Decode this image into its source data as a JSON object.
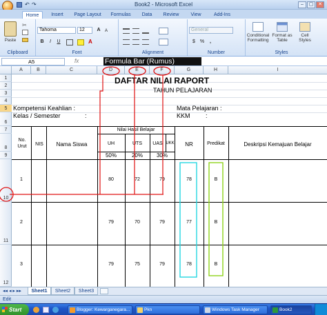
{
  "window": {
    "title": "Book2 - Microsoft Excel",
    "minimize": "–",
    "restore": "▢",
    "close": "✕"
  },
  "tabs": [
    "Home",
    "Insert",
    "Page Layout",
    "Formulas",
    "Data",
    "Review",
    "View",
    "Add-Ins"
  ],
  "ribbon": {
    "clipboard": {
      "label": "Clipboard",
      "paste": "Paste"
    },
    "font": {
      "label": "Font",
      "name": "Tahoma",
      "size": "12",
      "grow": "A",
      "shrink": "A",
      "bold": "B",
      "italic": "I",
      "underline": "U"
    },
    "alignment": {
      "label": "Alignment"
    },
    "number": {
      "label": "Number",
      "format": "General",
      "currency": "$",
      "percent": "%",
      "comma": ","
    },
    "styles": {
      "label": "Styles",
      "conditional": "Conditional Formatting",
      "format_table": "Format as Table",
      "cell_styles": "Cell Styles"
    }
  },
  "formula_bar": {
    "name_box": "A5",
    "fx": "fx",
    "annotation": "Formula Bar (Rumus)"
  },
  "columns": [
    "A",
    "B",
    "C",
    "D",
    "E",
    "F",
    "G",
    "H",
    "I"
  ],
  "rows": [
    "1",
    "2",
    "3",
    "4",
    "5",
    "6",
    "7",
    "8",
    "9",
    "10",
    "11",
    "12"
  ],
  "sheet": {
    "title": "DAFTAR NILAI RAPORT",
    "subtitle": "TAHUN PELAJARAN",
    "kompetensi": "Kompetensi Keahlian    :",
    "mata_pelajaran": "Mata Pelajaran :",
    "kelas": "Kelas / Semester",
    "kelas_colon": ":",
    "kkm": "KKM",
    "kkm_colon": ":",
    "headers": {
      "no_urut": "No. Urut",
      "nis": "NIS",
      "nama": "Nama Siswa",
      "nilai_hasil": "Nilai Hasil Belajar",
      "uh": "UH",
      "uts": "UTS",
      "uas": "UAS",
      "ukk": "UKK",
      "nr": "NR",
      "predikat": "Predikat",
      "deskripsi": "Deskripsi Kemajuan Belajar"
    },
    "weights": {
      "uh": "50%",
      "uts": "20%",
      "uas": "30%"
    },
    "students": [
      {
        "no": "1",
        "uh": "80",
        "uts": "72",
        "uas": "79",
        "nr": "78",
        "predikat": "B"
      },
      {
        "no": "2",
        "uh": "79",
        "uts": "70",
        "uas": "79",
        "nr": "77",
        "predikat": "B"
      },
      {
        "no": "3",
        "uh": "79",
        "uts": "75",
        "uas": "79",
        "nr": "78",
        "predikat": "B"
      }
    ]
  },
  "sheet_tabs": [
    "Sheet1",
    "Sheet2",
    "Sheet3"
  ],
  "status": "Edit",
  "taskbar": {
    "start": "Start",
    "tasks": [
      "Blogger: Kewarganegara...",
      "Pkn",
      "Windows Task Manager",
      "Book2"
    ]
  }
}
